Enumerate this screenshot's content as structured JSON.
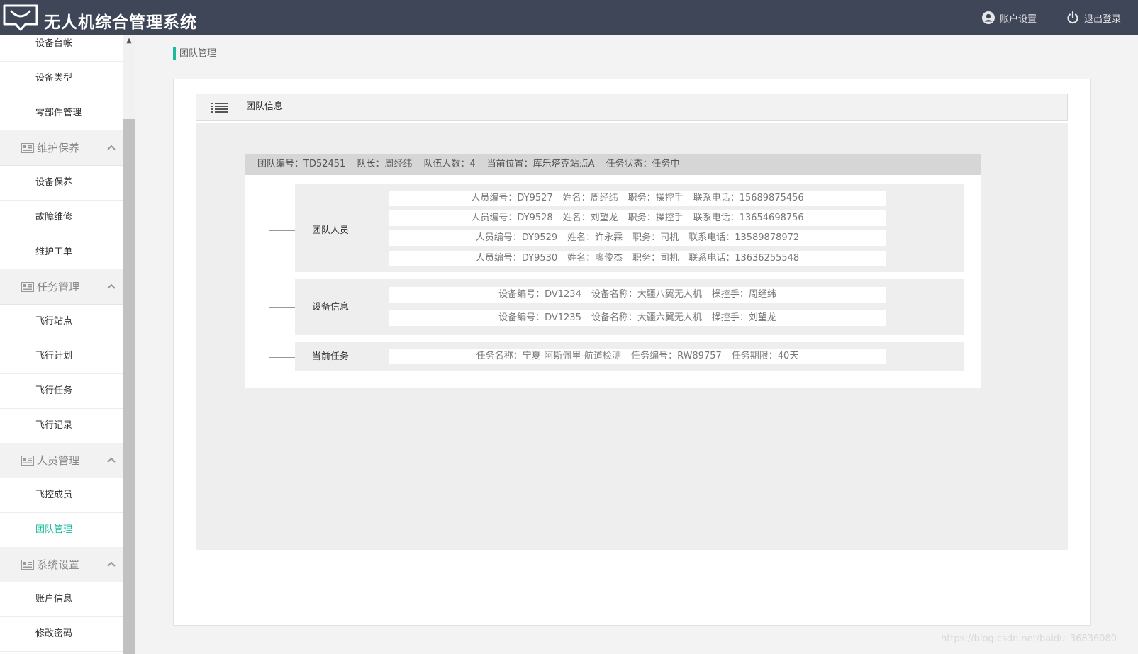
{
  "header": {
    "title": "无人机综合管理系统",
    "account_label": "账户设置",
    "logout_label": "退出登录"
  },
  "sidebar": {
    "items": [
      {
        "type": "item",
        "label": "设备台帐"
      },
      {
        "type": "item",
        "label": "设备类型"
      },
      {
        "type": "item",
        "label": "零部件管理"
      },
      {
        "type": "group",
        "label": "维护保养"
      },
      {
        "type": "item",
        "label": "设备保养"
      },
      {
        "type": "item",
        "label": "故障维修"
      },
      {
        "type": "item",
        "label": "维护工单"
      },
      {
        "type": "group",
        "label": "任务管理"
      },
      {
        "type": "item",
        "label": "飞行站点"
      },
      {
        "type": "item",
        "label": "飞行计划"
      },
      {
        "type": "item",
        "label": "飞行任务"
      },
      {
        "type": "item",
        "label": "飞行记录"
      },
      {
        "type": "group",
        "label": "人员管理"
      },
      {
        "type": "item",
        "label": "飞控成员"
      },
      {
        "type": "item",
        "label": "团队管理",
        "active": true
      },
      {
        "type": "group",
        "label": "系统设置"
      },
      {
        "type": "item",
        "label": "账户信息"
      },
      {
        "type": "item",
        "label": "修改密码"
      }
    ]
  },
  "breadcrumb": "团队管理",
  "panel_title": "团队信息",
  "team": {
    "fields": [
      "团队编号：TD52451",
      "队长：周经纬",
      "队伍人数：4",
      "当前位置：库乐塔克站点A",
      "任务状态：任务中"
    ],
    "members_label": "团队人员",
    "members": [
      [
        "人员编号：DY9527",
        "姓名：周经纬",
        "职务：操控手",
        "联系电话：15689875456"
      ],
      [
        "人员编号：DY9528",
        "姓名：刘望龙",
        "职务：操控手",
        "联系电话：13654698756"
      ],
      [
        "人员编号：DY9529",
        "姓名：许永霖",
        "职务：司机",
        "联系电话：13589878972"
      ],
      [
        "人员编号：DY9530",
        "姓名：廖俊杰",
        "职务：司机",
        "联系电话：13636255548"
      ]
    ],
    "devices_label": "设备信息",
    "devices": [
      [
        "设备编号：DV1234",
        "设备名称：大疆八翼无人机",
        "操控手：周经纬"
      ],
      [
        "设备编号：DV1235",
        "设备名称：大疆六翼无人机",
        "操控手：刘望龙"
      ]
    ],
    "task_label": "当前任务",
    "task": [
      "任务名称：宁夏-阿斯佩里-航道检测",
      "任务编号：RW89757",
      "任务期限：40天"
    ]
  },
  "watermark": "https://blog.csdn.net/baidu_36836080",
  "colors": {
    "header_bg": "#3f4657",
    "accent": "#1abc9c"
  },
  "icons": [
    "logo-icon",
    "user-icon",
    "power-icon",
    "list-icon",
    "group-icon",
    "chevron-up-icon"
  ]
}
